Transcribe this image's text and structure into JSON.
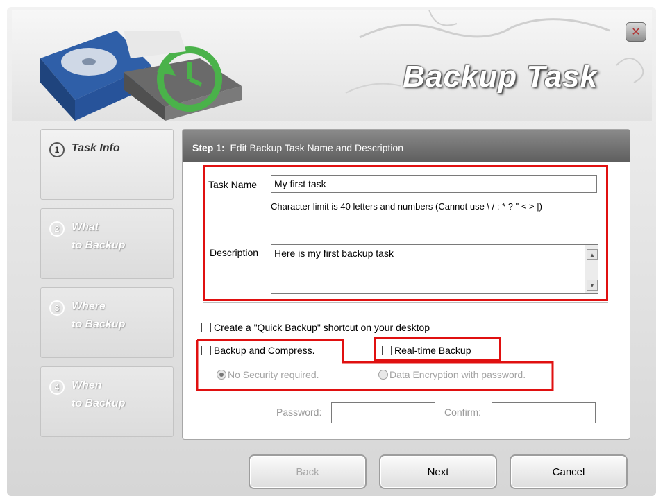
{
  "window": {
    "title": "Backup Task",
    "close_icon": "close-icon"
  },
  "sidebar": {
    "steps": [
      {
        "num": "1",
        "line1": "Task Info",
        "line2": "",
        "state": "active"
      },
      {
        "num": "2",
        "line1": "What",
        "line2": "to Backup",
        "state": "inactive"
      },
      {
        "num": "3",
        "line1": "Where",
        "line2": "to Backup",
        "state": "inactive"
      },
      {
        "num": "4",
        "line1": "When",
        "line2": "to Backup",
        "state": "inactive"
      }
    ]
  },
  "panel": {
    "step_label": "Step 1:",
    "step_title": "Edit Backup Task Name and Description",
    "task_name_label": "Task Name",
    "task_name_value": "My first task",
    "char_limit_hint": "Character limit is 40 letters and numbers (Cannot use \\ / : * ? \" < > |)",
    "description_label": "Description",
    "description_value": "Here is my first backup task",
    "quick_backup_label": "Create a \"Quick Backup\" shortcut on your desktop",
    "compress_label": "Backup and Compress.",
    "realtime_label": "Real-time Backup",
    "no_security_label": "No Security required.",
    "encryption_label": "Data Encryption with password.",
    "password_label": "Password:",
    "confirm_label": "Confirm:"
  },
  "buttons": {
    "back": "Back",
    "next": "Next",
    "cancel": "Cancel"
  },
  "colors": {
    "highlight": "#e01010",
    "panel_header": "#6e6e6e"
  }
}
